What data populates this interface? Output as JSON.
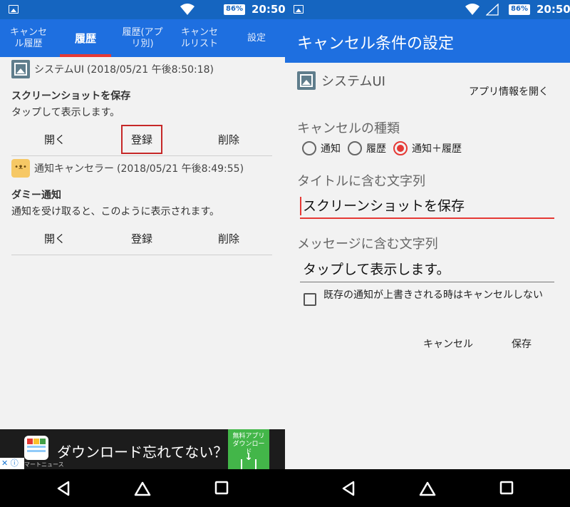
{
  "left": {
    "status": {
      "battery": "86%",
      "time": "20:50"
    },
    "tabs": [
      {
        "label": "キャンセル履歴",
        "active": false
      },
      {
        "label": "履歴",
        "active": true
      },
      {
        "label": "履歴(アプリ別)",
        "active": false
      },
      {
        "label": "キャンセルリスト",
        "active": false
      },
      {
        "label": "設定",
        "active": false
      }
    ],
    "entries": [
      {
        "app": "システムUI",
        "timestamp": "(2018/05/21 午後8:50:18)",
        "title": "スクリーンショットを保存",
        "message": "タップして表示します。",
        "actions": {
          "open": "開く",
          "register": "登録",
          "delete": "削除"
        },
        "icon": "image-icon"
      },
      {
        "app": "通知キャンセラー",
        "timestamp": "(2018/05/21 午後8:49:55)",
        "title": "ダミー通知",
        "message": "通知を受け取ると、このように表示されます。",
        "actions": {
          "open": "開く",
          "register": "登録",
          "delete": "削除"
        },
        "icon": "cat-icon"
      }
    ],
    "ad": {
      "text": "ダウンロード忘れてない？",
      "cta": "無料アプリダウンロード",
      "source": "マートニュース"
    },
    "colors": {
      "primary": "#1e6fe0",
      "accent": "#e53935",
      "highlight": "#c62828",
      "ad_cta": "#43b649"
    }
  },
  "right": {
    "status": {
      "battery": "86%",
      "time": "20:50"
    },
    "title": "キャンセル条件の設定",
    "app_name": "システムUI",
    "app_info": "アプリ情報を開く",
    "type_label": "キャンセルの種類",
    "radios": [
      {
        "label": "通知",
        "selected": false
      },
      {
        "label": "履歴",
        "selected": false
      },
      {
        "label": "通知＋履歴",
        "selected": true
      }
    ],
    "title_label": "タイトルに含む文字列",
    "title_value": "スクリーンショットを保存",
    "message_label": "メッセージに含む文字列",
    "message_value": "タップして表示します。",
    "checkbox_label": "既存の通知が上書きされる時はキャンセルしない",
    "checkbox_checked": false,
    "cancel_button": "キャンセル",
    "save_button": "保存"
  }
}
